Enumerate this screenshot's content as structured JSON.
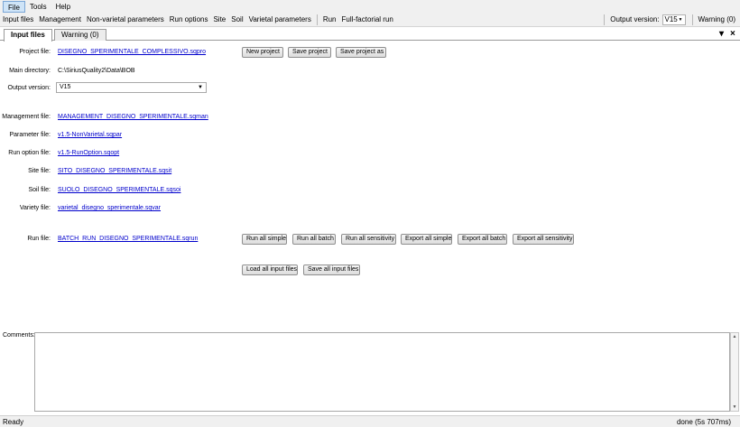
{
  "menu": {
    "file": "File",
    "tools": "Tools",
    "help": "Help"
  },
  "toolbar": {
    "input_files": "Input files",
    "management": "Management",
    "non_varietal": "Non-varietal parameters",
    "run_options": "Run options",
    "site": "Site",
    "soil": "Soil",
    "varietal": "Varietal parameters",
    "run": "Run",
    "full_factorial": "Full-factorial run",
    "output_version_label": "Output version:",
    "output_version_value": "V15",
    "warning": "Warning (0)"
  },
  "tabs": {
    "input_files": "Input files",
    "warning": "Warning (0)",
    "pin": "▾",
    "close": "×"
  },
  "form": {
    "project_file_label": "Project file:",
    "project_file_value": "DISEGNO_SPERIMENTALE_COMPLESSIVO.sqpro",
    "main_directory_label": "Main directory:",
    "main_directory_value": "C:\\SiriusQuality2\\Data\\BOB",
    "output_version_label": "Output version:",
    "output_version_value": "V15",
    "management_file_label": "Management file:",
    "management_file_value": "MANAGEMENT_DISEGNO_SPERIMENTALE.sqman",
    "parameter_file_label": "Parameter file:",
    "parameter_file_value": "v1.5-NonVarietal.sqpar",
    "run_option_file_label": "Run option file:",
    "run_option_file_value": "v1.5-RunOption.sqopt",
    "site_file_label": "Site file:",
    "site_file_value": "SITO_DISEGNO_SPERIMENTALE.sqsit",
    "soil_file_label": "Soil file:",
    "soil_file_value": "SUOLO_DISEGNO_SPERIMENTALE.sqsoi",
    "variety_file_label": "Variety file:",
    "variety_file_value": "varietal_disegno_sperimentale.sqvar",
    "run_file_label": "Run file:",
    "run_file_value": "BATCH_RUN_DISEGNO_SPERIMENTALE.sqrun"
  },
  "buttons": {
    "new_project": "New project",
    "save_project": "Save project",
    "save_project_as": "Save project as",
    "run_all_simple": "Run all simple",
    "run_all_batch": "Run all batch",
    "run_all_sensitivity": "Run all sensitivity",
    "export_all_simple": "Export all simple",
    "export_all_batch": "Export all batch",
    "export_all_sensitivity": "Export all sensitivity",
    "load_all_input_files": "Load all input files",
    "save_all_input_files": "Save all input files"
  },
  "comments": {
    "label": "Comments:"
  },
  "status": {
    "left": "Ready",
    "right": "done (5s 707ms)"
  },
  "icons": {
    "dropdown_arrow": "chevron-down-icon",
    "pin": "pin-icon",
    "close": "close-icon",
    "scroll_up": "scroll-up-icon",
    "scroll_down": "scroll-down-icon"
  },
  "colors": {
    "link": "#0000cc",
    "menu_active": "#cfe4f7",
    "chrome": "#f0f0f0"
  }
}
